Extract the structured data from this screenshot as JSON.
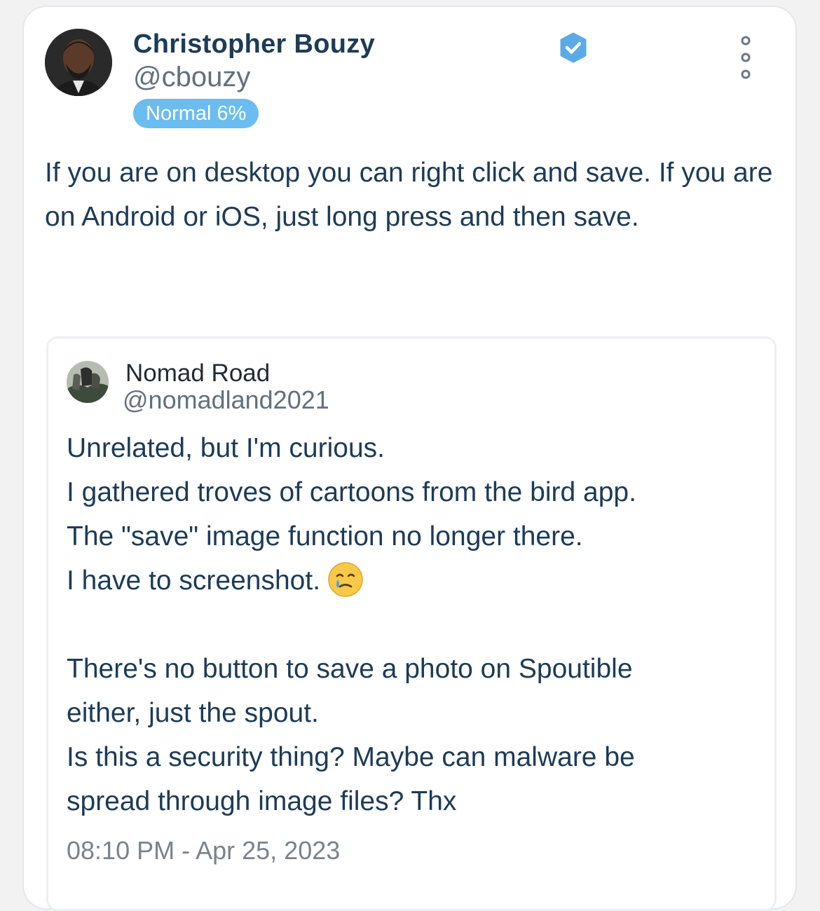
{
  "post": {
    "author_name": "Christopher Bouzy",
    "author_handle": "@cbouzy",
    "badge": "Normal 6%",
    "verified_icon": "verified-check-icon",
    "menu_icon": "more-options-icon",
    "text": "If you are on desktop you can right click and save. If you are on Android or iOS, just long press and then save."
  },
  "quote": {
    "author_name": "Nomad Road",
    "author_handle": "@nomadland2021",
    "lines": [
      "Unrelated, but I'm curious.",
      "I gathered troves of cartoons from the bird app.",
      "The \"save\" image function no longer there.",
      "I have to screenshot."
    ],
    "emoji": "smiling-face-with-tear",
    "lines2": [
      "There's no button to save a photo on Spoutible",
      "either, just the spout.",
      "Is this a security thing? Maybe can malware be",
      "spread through image files? Thx"
    ],
    "timestamp": "08:10 PM - Apr 25, 2023"
  },
  "colors": {
    "text_primary": "#1d3b56",
    "text_secondary": "#63707c",
    "badge_bg": "#6bbcf0",
    "verified_blue": "#5aaae7"
  }
}
